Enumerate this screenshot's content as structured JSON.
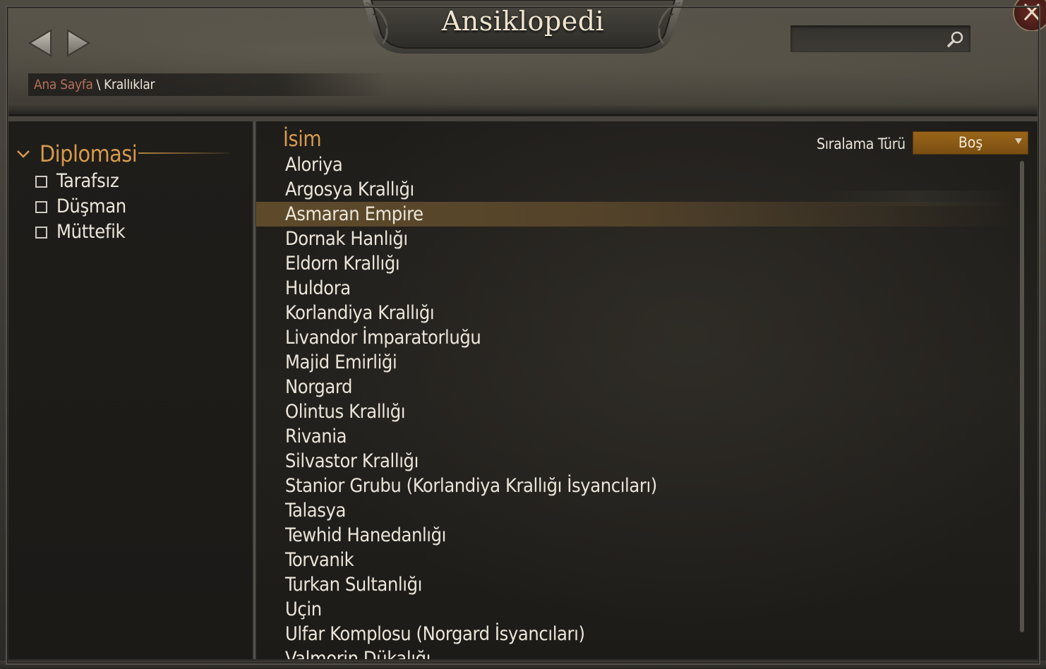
{
  "header": {
    "title": "Ansiklopedi",
    "search_placeholder": ""
  },
  "breadcrumb": {
    "home": "Ana Sayfa",
    "separator": "\\",
    "current": "Krallıklar"
  },
  "filters": {
    "group_title": "Diplomasi",
    "items": [
      {
        "label": "Tarafsız",
        "checked": false
      },
      {
        "label": "Düşman",
        "checked": false
      },
      {
        "label": "Müttefik",
        "checked": false
      }
    ]
  },
  "list": {
    "column_header": "İsim",
    "sort_label": "Sıralama Türü",
    "sort_value": "Boş",
    "selected_index": 2,
    "items": [
      "Aloriya",
      "Argosya Krallığı",
      "Asmaran Empire",
      "Dornak Hanlığı",
      "Eldorn Krallığı",
      "Huldora",
      "Korlandiya Krallığı",
      "Livandor İmparatorluğu",
      "Majid Emirliği",
      "Norgard",
      "Olintus Krallığı",
      "Rivania",
      "Silvastor Krallığı",
      "Stanior Grubu (Korlandiya Krallığı İsyancıları)",
      "Talasya",
      "Tewhid Hanedanlığı",
      "Torvanik",
      "Turkan Sultanlığı",
      "Uçin",
      "Ulfar Komplosu (Norgard İsyancıları)",
      "Valmorin Dükalığı"
    ]
  },
  "colors": {
    "accent_gold": "#d79a4c",
    "breadcrumb_home": "#b4705a",
    "text_light": "#ece6da",
    "dropdown_bg": "#9a6418",
    "selected_row": "#5e4a2b"
  },
  "icons": {
    "back": "left-triangle-arrow",
    "forward": "right-triangle-arrow",
    "search": "magnifier",
    "close": "x-mark",
    "expand": "chevron-down",
    "dropdown": "caret-down"
  }
}
